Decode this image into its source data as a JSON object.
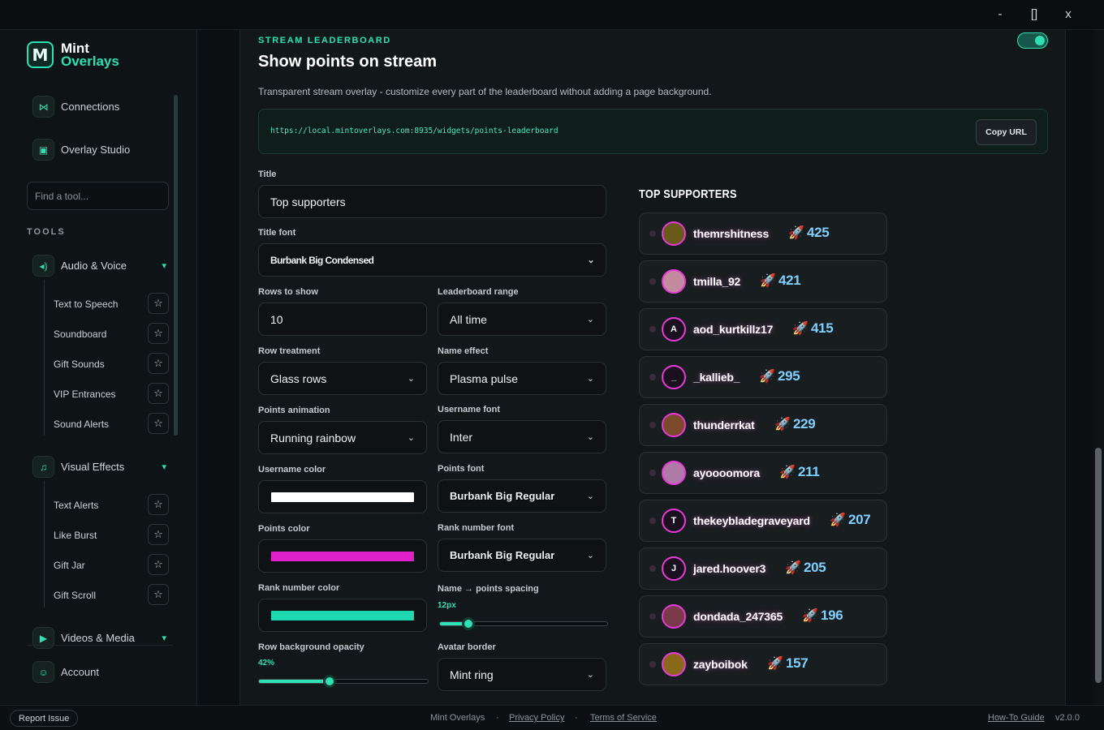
{
  "window": {
    "minimize": "-",
    "maximize": "[]",
    "close": "x"
  },
  "brand": {
    "mark": "M",
    "line1": "Mint",
    "line2": "Overlays"
  },
  "sidebar": {
    "top_items": [
      {
        "label": "Connections",
        "icon": "share-icon"
      },
      {
        "label": "Overlay Studio",
        "icon": "layout-icon"
      }
    ],
    "search_placeholder": "Find a tool...",
    "section_label": "TOOLS",
    "groups": [
      {
        "label": "Audio & Voice",
        "icon": "speaker-icon",
        "items": [
          "Text to Speech",
          "Soundboard",
          "Gift Sounds",
          "VIP Entrances",
          "Sound Alerts"
        ]
      },
      {
        "label": "Visual Effects",
        "icon": "bell-icon",
        "items": [
          "Text Alerts",
          "Like Burst",
          "Gift Jar",
          "Gift Scroll"
        ]
      },
      {
        "label": "Videos & Media",
        "icon": "video-icon",
        "items": []
      }
    ],
    "account": "Account"
  },
  "panel": {
    "eyebrow": "STREAM LEADERBOARD",
    "title": "Show points on stream",
    "enabled": true,
    "description": "Transparent stream overlay - customize every part of the leaderboard without adding a page background.",
    "url": "https://local.mintoverlays.com:8935/widgets/points-leaderboard",
    "copy_label": "Copy URL"
  },
  "form": {
    "title_label": "Title",
    "title_value": "Top supporters",
    "title_font_label": "Title font",
    "title_font_value": "Burbank Big Condensed",
    "rows_label": "Rows to show",
    "rows_value": "10",
    "range_label": "Leaderboard range",
    "range_value": "All time",
    "row_treatment_label": "Row treatment",
    "row_treatment_value": "Glass rows",
    "name_effect_label": "Name effect",
    "name_effect_value": "Plasma pulse",
    "points_anim_label": "Points animation",
    "points_anim_value": "Running rainbow",
    "username_font_label": "Username font",
    "username_font_value": "Inter",
    "username_color_label": "Username color",
    "username_color": "#ffffff",
    "points_font_label": "Points font",
    "points_font_value": "Burbank Big Regular",
    "points_color_label": "Points color",
    "points_color": "#e020c8",
    "rank_font_label": "Rank number font",
    "rank_font_value": "Burbank Big Regular",
    "rank_color_label": "Rank number color",
    "rank_color": "#1ed8b0",
    "spacing_label": "Name → points spacing",
    "spacing_value": "12px",
    "spacing_fraction": 0.17,
    "opacity_label": "Row background opacity",
    "opacity_value": "42%",
    "opacity_fraction": 0.42,
    "avatar_border_label": "Avatar border",
    "avatar_border_value": "Mint ring"
  },
  "leaderboard": {
    "title": "TOP SUPPORTERS",
    "rows": [
      {
        "name": "themrshitness",
        "points": "425",
        "initial": "",
        "avatar_color": "#6a5a1a"
      },
      {
        "name": "tmilla_92",
        "points": "421",
        "initial": "",
        "avatar_color": "#c48aa0"
      },
      {
        "name": "aod_kurtkillz17",
        "points": "415",
        "initial": "A",
        "avatar_color": "#1a1020"
      },
      {
        "name": "_kallieb_",
        "points": "295",
        "initial": "_",
        "avatar_color": "#1a1020"
      },
      {
        "name": "thunderrkat",
        "points": "229",
        "initial": "",
        "avatar_color": "#7a4a2a"
      },
      {
        "name": "ayoooomora",
        "points": "211",
        "initial": "",
        "avatar_color": "#b07aa8"
      },
      {
        "name": "thekeybladegraveyard",
        "points": "207",
        "initial": "T",
        "avatar_color": "#1a1020"
      },
      {
        "name": "jared.hoover3",
        "points": "205",
        "initial": "J",
        "avatar_color": "#1a1020"
      },
      {
        "name": "dondada_247365",
        "points": "196",
        "initial": "",
        "avatar_color": "#7a3a4a"
      },
      {
        "name": "zayboibok",
        "points": "157",
        "initial": "",
        "avatar_color": "#8a6a1a"
      }
    ]
  },
  "footer": {
    "report": "Report Issue",
    "brand": "Mint Overlays",
    "privacy": "Privacy Policy",
    "terms": "Terms of Service",
    "sep": "·",
    "guide": "How-To Guide",
    "version": "v2.0.0"
  },
  "colors": {
    "accent": "#2ee0b4",
    "magenta": "#e83ad6"
  }
}
